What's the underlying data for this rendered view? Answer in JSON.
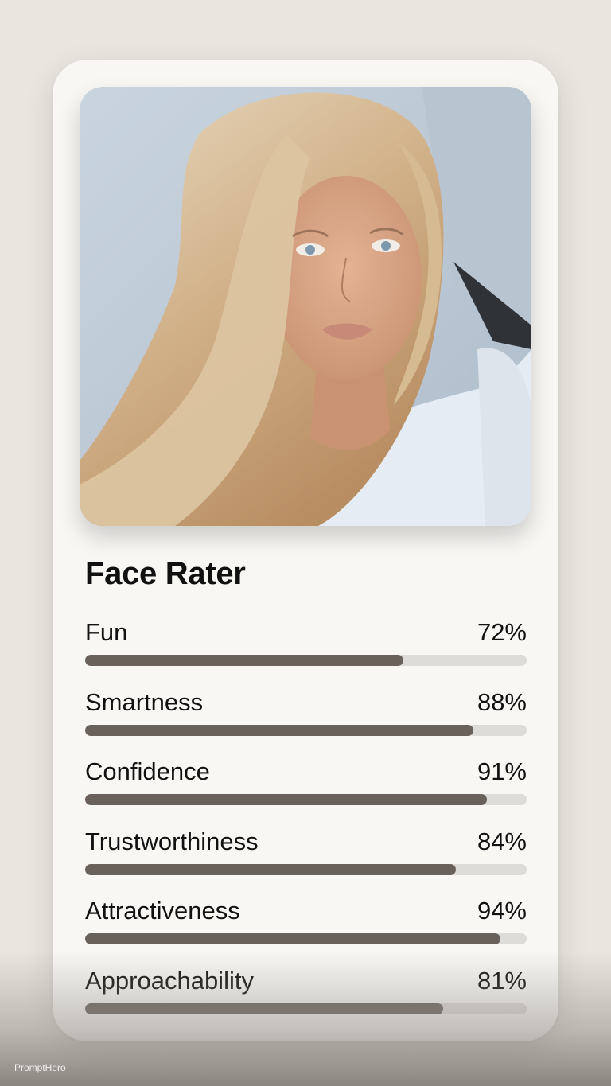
{
  "app": {
    "title": "Face Rater"
  },
  "photo": {
    "description_icon": "portrait-photo"
  },
  "metrics": [
    {
      "label": "Fun",
      "value_text": "72%",
      "value": 72
    },
    {
      "label": "Smartness",
      "value_text": "88%",
      "value": 88
    },
    {
      "label": "Confidence",
      "value_text": "91%",
      "value": 91
    },
    {
      "label": "Trustworthiness",
      "value_text": "84%",
      "value": 84
    },
    {
      "label": "Attractiveness",
      "value_text": "94%",
      "value": 94
    },
    {
      "label": "Approachability",
      "value_text": "81%",
      "value": 81
    }
  ],
  "watermark": "PromptHero",
  "colors": {
    "background": "#e9e6df",
    "card": "#f8f7f4",
    "bar_fill": "#6a615a",
    "bar_track": "#dedcd8"
  }
}
